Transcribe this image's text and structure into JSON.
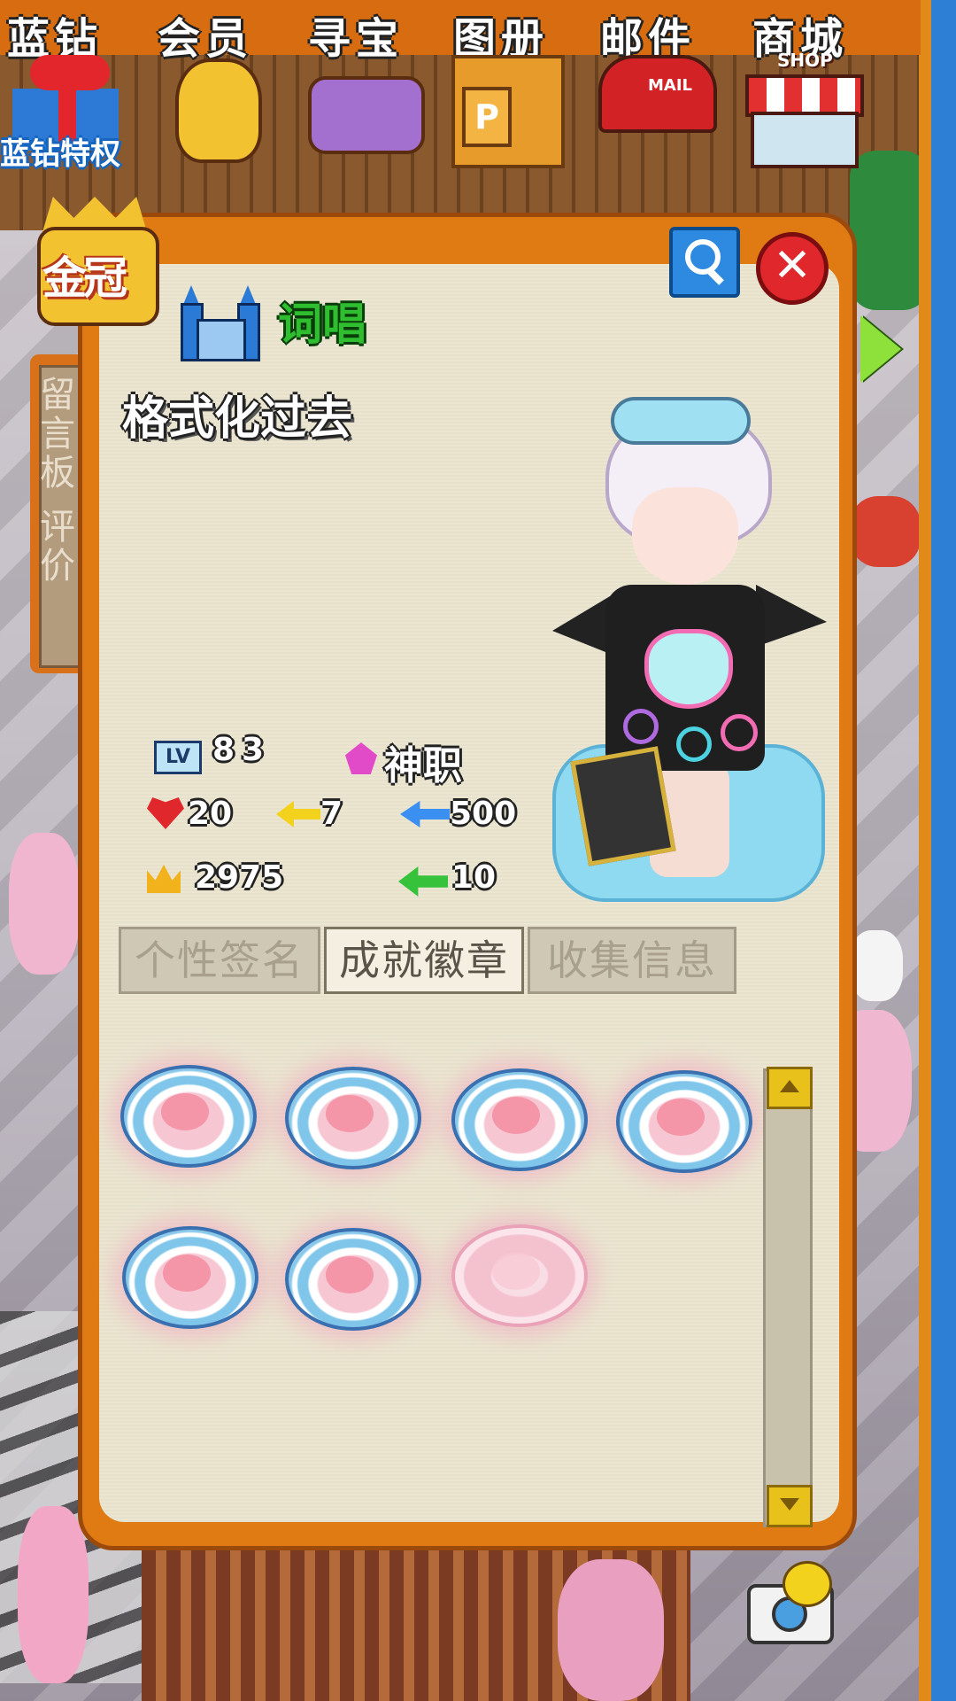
{
  "top_menu": {
    "items": [
      {
        "label": "蓝钻"
      },
      {
        "label": "会员"
      },
      {
        "label": "寻宝"
      },
      {
        "label": "图册"
      },
      {
        "label": "邮件"
      },
      {
        "label": "商城"
      }
    ],
    "blue_diamond_caption": "蓝钻特权",
    "album_icon_letter": "P",
    "mail_icon_text": "MAIL",
    "shop_icon_text": "SHOP"
  },
  "crown_badge": {
    "label": "金冠"
  },
  "side_tab": {
    "label": "留言板 评价"
  },
  "profile": {
    "guild_name": "词唱",
    "nickname": "格式化过去",
    "level_prefix": "LV",
    "level": "83",
    "title": "神职",
    "hearts": "20",
    "yellow_arrows": "7",
    "blue_arrows": "500",
    "crowns": "2975",
    "green_arrows": "10"
  },
  "tabs": [
    {
      "label": "个性签名",
      "active": false
    },
    {
      "label": "成就徽章",
      "active": true
    },
    {
      "label": "收集信息",
      "active": false
    }
  ],
  "badges": {
    "count_earned": 6,
    "count_shown": 7
  },
  "colors": {
    "frame_orange": "#e07a13",
    "panel_bg": "#ece6d1",
    "close_red": "#e0282c",
    "search_blue": "#2d8ae0",
    "guild_green": "#2fbe2f"
  },
  "icons": [
    "search-icon",
    "close-icon",
    "next-arrow-icon",
    "castle-icon",
    "gem-icon",
    "heart-icon",
    "crown-icon",
    "camera-icon"
  ]
}
